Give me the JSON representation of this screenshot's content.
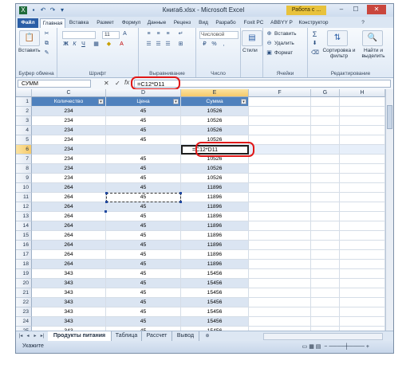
{
  "window": {
    "title": "Книга6.xlsx - Microsoft Excel",
    "context_tab": "Работа с ...",
    "controls": [
      "–",
      "☐",
      "✕"
    ]
  },
  "tabs": [
    "Файл",
    "Главная",
    "Вставка",
    "Размет",
    "Формул",
    "Данные",
    "Реценз",
    "Вид",
    "Разрабо",
    "Foxit PC",
    "ABBYY P",
    "Конструктор"
  ],
  "ribbon": {
    "paste": "Вставить",
    "clipboard": "Буфер обмена",
    "font": "Шрифт",
    "font_size": "11",
    "alignment": "Выравнивание",
    "number_format": "Числовой",
    "number": "Число",
    "styles": "Стили",
    "insert": "Вставить",
    "delete": "Удалить",
    "format": "Формат",
    "cells": "Ячейки",
    "sum": "Σ",
    "sort": "Сортировка и фильтр",
    "find": "Найти и выделить",
    "editing": "Редактирование"
  },
  "formula_bar": {
    "name_box": "СУММ",
    "cancel": "✕",
    "enter": "✓",
    "fx": "fx",
    "formula": "=C12*D11"
  },
  "columns": [
    "C",
    "D",
    "E",
    "F",
    "G",
    "H"
  ],
  "headers": [
    "Количество",
    "Цена",
    "Сумма"
  ],
  "rows": [
    {
      "n": "1",
      "c": "",
      "d": "",
      "e": ""
    },
    {
      "n": "2",
      "c": "234",
      "d": "45",
      "e": "10526"
    },
    {
      "n": "3",
      "c": "234",
      "d": "45",
      "e": "10526"
    },
    {
      "n": "4",
      "c": "234",
      "d": "45",
      "e": "10526"
    },
    {
      "n": "5",
      "c": "234",
      "d": "45",
      "e": "10526"
    },
    {
      "n": "6",
      "c": "234",
      "d": "",
      "e": "=C12*D11"
    },
    {
      "n": "7",
      "c": "234",
      "d": "45",
      "e": "10526"
    },
    {
      "n": "8",
      "c": "234",
      "d": "45",
      "e": "10526"
    },
    {
      "n": "9",
      "c": "234",
      "d": "45",
      "e": "10526"
    },
    {
      "n": "10",
      "c": "264",
      "d": "45",
      "e": "11896"
    },
    {
      "n": "11",
      "c": "264",
      "d": "45",
      "e": "11896"
    },
    {
      "n": "12",
      "c": "264",
      "d": "45",
      "e": "11896"
    },
    {
      "n": "13",
      "c": "264",
      "d": "45",
      "e": "11896"
    },
    {
      "n": "14",
      "c": "264",
      "d": "45",
      "e": "11896"
    },
    {
      "n": "15",
      "c": "264",
      "d": "45",
      "e": "11896"
    },
    {
      "n": "16",
      "c": "264",
      "d": "45",
      "e": "11896"
    },
    {
      "n": "17",
      "c": "264",
      "d": "45",
      "e": "11896"
    },
    {
      "n": "18",
      "c": "264",
      "d": "45",
      "e": "11896"
    },
    {
      "n": "19",
      "c": "343",
      "d": "45",
      "e": "15456"
    },
    {
      "n": "20",
      "c": "343",
      "d": "45",
      "e": "15456"
    },
    {
      "n": "21",
      "c": "343",
      "d": "45",
      "e": "15456"
    },
    {
      "n": "22",
      "c": "343",
      "d": "45",
      "e": "15456"
    },
    {
      "n": "23",
      "c": "343",
      "d": "45",
      "e": "15456"
    },
    {
      "n": "24",
      "c": "343",
      "d": "45",
      "e": "15456"
    },
    {
      "n": "25",
      "c": "343",
      "d": "45",
      "e": "15456"
    }
  ],
  "sheets": [
    "Продукты питания",
    "Таблица",
    "Рассчет",
    "Вывод"
  ],
  "status": "Укажите"
}
